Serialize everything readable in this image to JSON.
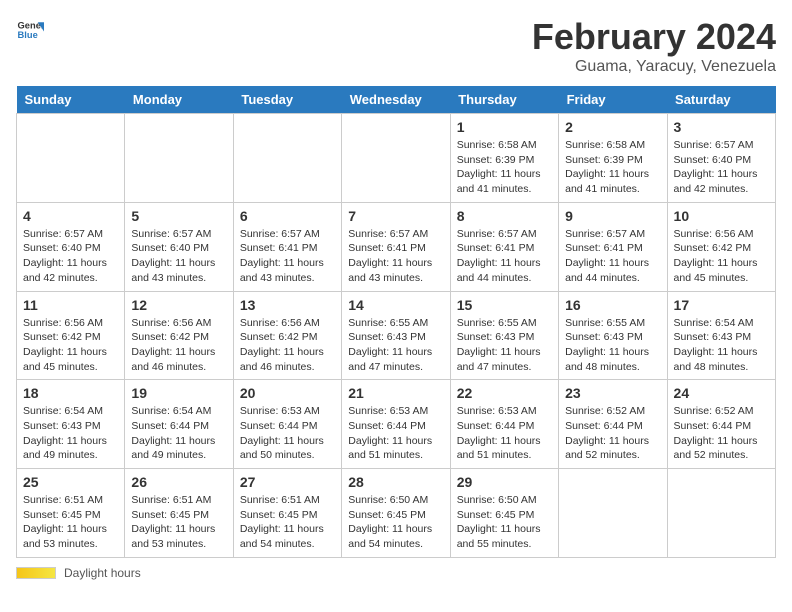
{
  "header": {
    "logo_general": "General",
    "logo_blue": "Blue",
    "title": "February 2024",
    "subtitle": "Guama, Yaracuy, Venezuela"
  },
  "days_of_week": [
    "Sunday",
    "Monday",
    "Tuesday",
    "Wednesday",
    "Thursday",
    "Friday",
    "Saturday"
  ],
  "weeks": [
    [
      {
        "day": "",
        "info": ""
      },
      {
        "day": "",
        "info": ""
      },
      {
        "day": "",
        "info": ""
      },
      {
        "day": "",
        "info": ""
      },
      {
        "day": "1",
        "info": "Sunrise: 6:58 AM\nSunset: 6:39 PM\nDaylight: 11 hours and 41 minutes."
      },
      {
        "day": "2",
        "info": "Sunrise: 6:58 AM\nSunset: 6:39 PM\nDaylight: 11 hours and 41 minutes."
      },
      {
        "day": "3",
        "info": "Sunrise: 6:57 AM\nSunset: 6:40 PM\nDaylight: 11 hours and 42 minutes."
      }
    ],
    [
      {
        "day": "4",
        "info": "Sunrise: 6:57 AM\nSunset: 6:40 PM\nDaylight: 11 hours and 42 minutes."
      },
      {
        "day": "5",
        "info": "Sunrise: 6:57 AM\nSunset: 6:40 PM\nDaylight: 11 hours and 43 minutes."
      },
      {
        "day": "6",
        "info": "Sunrise: 6:57 AM\nSunset: 6:41 PM\nDaylight: 11 hours and 43 minutes."
      },
      {
        "day": "7",
        "info": "Sunrise: 6:57 AM\nSunset: 6:41 PM\nDaylight: 11 hours and 43 minutes."
      },
      {
        "day": "8",
        "info": "Sunrise: 6:57 AM\nSunset: 6:41 PM\nDaylight: 11 hours and 44 minutes."
      },
      {
        "day": "9",
        "info": "Sunrise: 6:57 AM\nSunset: 6:41 PM\nDaylight: 11 hours and 44 minutes."
      },
      {
        "day": "10",
        "info": "Sunrise: 6:56 AM\nSunset: 6:42 PM\nDaylight: 11 hours and 45 minutes."
      }
    ],
    [
      {
        "day": "11",
        "info": "Sunrise: 6:56 AM\nSunset: 6:42 PM\nDaylight: 11 hours and 45 minutes."
      },
      {
        "day": "12",
        "info": "Sunrise: 6:56 AM\nSunset: 6:42 PM\nDaylight: 11 hours and 46 minutes."
      },
      {
        "day": "13",
        "info": "Sunrise: 6:56 AM\nSunset: 6:42 PM\nDaylight: 11 hours and 46 minutes."
      },
      {
        "day": "14",
        "info": "Sunrise: 6:55 AM\nSunset: 6:43 PM\nDaylight: 11 hours and 47 minutes."
      },
      {
        "day": "15",
        "info": "Sunrise: 6:55 AM\nSunset: 6:43 PM\nDaylight: 11 hours and 47 minutes."
      },
      {
        "day": "16",
        "info": "Sunrise: 6:55 AM\nSunset: 6:43 PM\nDaylight: 11 hours and 48 minutes."
      },
      {
        "day": "17",
        "info": "Sunrise: 6:54 AM\nSunset: 6:43 PM\nDaylight: 11 hours and 48 minutes."
      }
    ],
    [
      {
        "day": "18",
        "info": "Sunrise: 6:54 AM\nSunset: 6:43 PM\nDaylight: 11 hours and 49 minutes."
      },
      {
        "day": "19",
        "info": "Sunrise: 6:54 AM\nSunset: 6:44 PM\nDaylight: 11 hours and 49 minutes."
      },
      {
        "day": "20",
        "info": "Sunrise: 6:53 AM\nSunset: 6:44 PM\nDaylight: 11 hours and 50 minutes."
      },
      {
        "day": "21",
        "info": "Sunrise: 6:53 AM\nSunset: 6:44 PM\nDaylight: 11 hours and 51 minutes."
      },
      {
        "day": "22",
        "info": "Sunrise: 6:53 AM\nSunset: 6:44 PM\nDaylight: 11 hours and 51 minutes."
      },
      {
        "day": "23",
        "info": "Sunrise: 6:52 AM\nSunset: 6:44 PM\nDaylight: 11 hours and 52 minutes."
      },
      {
        "day": "24",
        "info": "Sunrise: 6:52 AM\nSunset: 6:44 PM\nDaylight: 11 hours and 52 minutes."
      }
    ],
    [
      {
        "day": "25",
        "info": "Sunrise: 6:51 AM\nSunset: 6:45 PM\nDaylight: 11 hours and 53 minutes."
      },
      {
        "day": "26",
        "info": "Sunrise: 6:51 AM\nSunset: 6:45 PM\nDaylight: 11 hours and 53 minutes."
      },
      {
        "day": "27",
        "info": "Sunrise: 6:51 AM\nSunset: 6:45 PM\nDaylight: 11 hours and 54 minutes."
      },
      {
        "day": "28",
        "info": "Sunrise: 6:50 AM\nSunset: 6:45 PM\nDaylight: 11 hours and 54 minutes."
      },
      {
        "day": "29",
        "info": "Sunrise: 6:50 AM\nSunset: 6:45 PM\nDaylight: 11 hours and 55 minutes."
      },
      {
        "day": "",
        "info": ""
      },
      {
        "day": "",
        "info": ""
      }
    ]
  ],
  "footer": {
    "daylight_label": "Daylight hours"
  }
}
